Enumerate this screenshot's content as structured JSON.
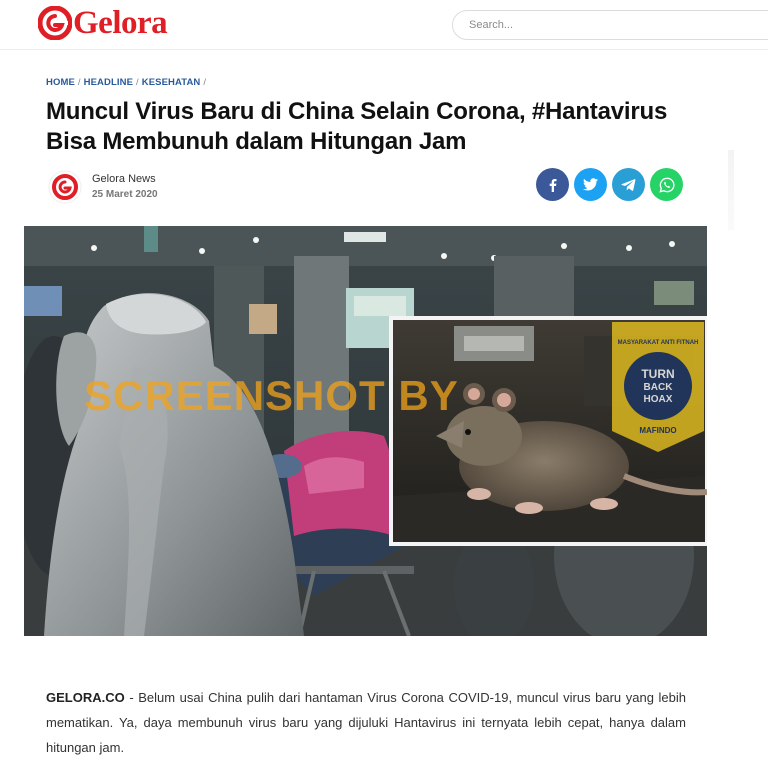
{
  "site": {
    "logo_text": "Gelora",
    "brand_color": "#e01e26"
  },
  "search": {
    "placeholder": "Search..."
  },
  "breadcrumb": {
    "items": [
      "HOME",
      "HEADLINE",
      "KESEHATAN"
    ]
  },
  "article": {
    "title": "Muncul Virus Baru di China Selain Corona, #Hantavirus Bisa Membunuh dalam Hitungan Jam",
    "author": "Gelora News",
    "date": "25 Maret 2020",
    "image": {
      "watermark": "SCREENSHOT BY",
      "badge_center": "TURN BACK HOAX",
      "badge_ring_top": "MASYARAKAT ANTI FITNAH INDONESIA",
      "badge_ring_bottom": "MAFINDO"
    },
    "lead_source": "GELORA.CO",
    "lead_body": "- Belum usai China pulih dari hantaman Virus Corona COVID-19, muncul virus baru yang lebih mematikan. Ya, daya membunuh virus baru yang dijuluki Hantavirus ini ternyata lebih cepat, hanya dalam hitungan jam."
  },
  "share": {
    "buttons": [
      "facebook",
      "twitter",
      "telegram",
      "whatsapp"
    ],
    "colors": {
      "facebook": "#3b5998",
      "twitter": "#1da1f2",
      "telegram": "#2a9fd6",
      "whatsapp": "#25d366"
    }
  },
  "icons": {
    "logo": "gelora-swirl-icon",
    "facebook": "facebook-icon",
    "twitter": "twitter-icon",
    "telegram": "telegram-icon",
    "whatsapp": "whatsapp-icon"
  }
}
